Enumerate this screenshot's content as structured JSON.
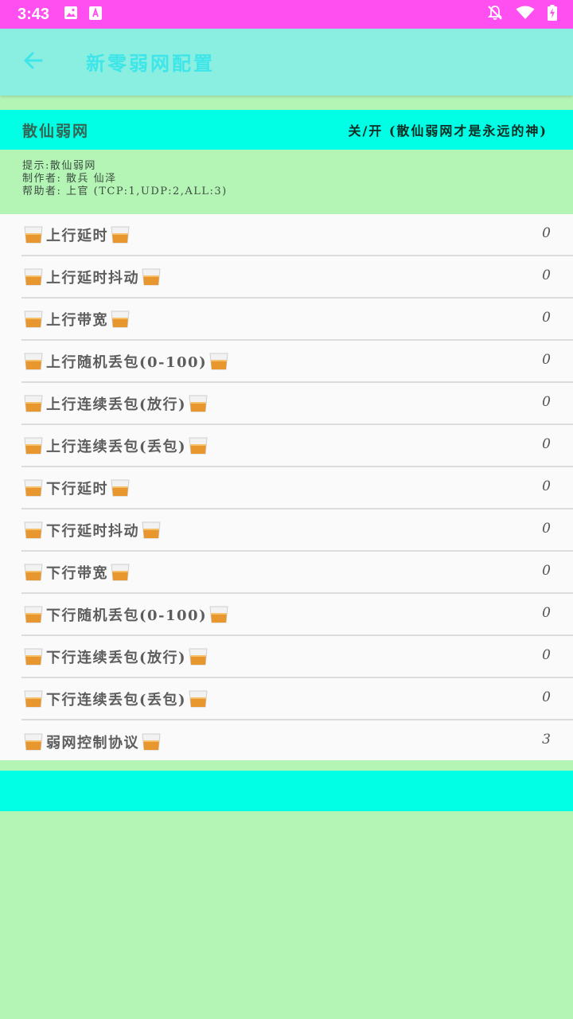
{
  "status_bar": {
    "time": "3:43",
    "bg_color": "#ff4ff0",
    "left_icons": [
      "image-icon",
      "font-download-icon"
    ],
    "right_icons": [
      "notifications-off-icon",
      "wifi-icon",
      "battery-charging-icon"
    ]
  },
  "toolbar": {
    "title": "新零弱网配置",
    "back_icon": "arrow-back-icon",
    "bg_color": "#8aeee0"
  },
  "switch_bar": {
    "label": "散仙弱网",
    "toggle_text": "关/开 (散仙弱网才是永远的神)",
    "bg_color": "#00ffe4"
  },
  "info": {
    "tip": "提示:散仙弱网",
    "author": "制作者:  散兵  仙泽",
    "helper": "帮助者:  上官  (TCP:1,UDP:2,ALL:3)"
  },
  "settings": [
    {
      "label": "上行延时",
      "value": "0"
    },
    {
      "label": "上行延时抖动",
      "value": "0"
    },
    {
      "label": "上行带宽",
      "value": "0"
    },
    {
      "label": "上行随机丢包(0-100)",
      "value": "0"
    },
    {
      "label": "上行连续丢包(放行)",
      "value": "0"
    },
    {
      "label": "上行连续丢包(丢包)",
      "value": "0"
    },
    {
      "label": "下行延时",
      "value": "0"
    },
    {
      "label": "下行延时抖动",
      "value": "0"
    },
    {
      "label": "下行带宽",
      "value": "0"
    },
    {
      "label": "下行随机丢包(0-100)",
      "value": "0"
    },
    {
      "label": "下行连续丢包(放行)",
      "value": "0"
    },
    {
      "label": "下行连续丢包(丢包)",
      "value": "0"
    },
    {
      "label": "弱网控制协议",
      "value": "3"
    }
  ],
  "row_icon": "whisky-glass-icon",
  "page_bg_color": "#b4f5b6"
}
